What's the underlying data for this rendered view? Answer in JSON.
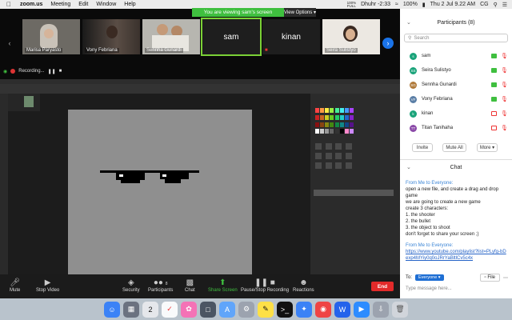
{
  "menubar": {
    "items": [
      "zoom.us",
      "Meeting",
      "Edit",
      "Window",
      "Help"
    ],
    "status": {
      "battery_pct": "100%",
      "battery_label": "FULL",
      "prayer": "Dhuhr -2:33",
      "percent": "100%",
      "datetime": "Thu 2 Jul  9.22 AM",
      "user": "CG"
    }
  },
  "banner": {
    "viewing": "You are viewing sam's screen",
    "view_options": "View Options ▾"
  },
  "gallery": [
    {
      "name": "Marisa Paryasto",
      "type": "video"
    },
    {
      "name": "Vony Febriana",
      "type": "video"
    },
    {
      "name": "Sennha Gunardi",
      "type": "video"
    },
    {
      "name": "sam",
      "type": "name",
      "active": true
    },
    {
      "name": "kinan",
      "type": "name"
    },
    {
      "name": "Seira Sulistyo",
      "type": "video"
    }
  ],
  "recording": {
    "label": "Recording..."
  },
  "controls": {
    "mute": "Mute",
    "stop_video": "Stop Video",
    "security": "Security",
    "participants": "Participants",
    "participants_count": "8",
    "chat": "Chat",
    "share_screen": "Share Screen",
    "pause_recording": "Pause/Stop Recording",
    "reactions": "Reactions",
    "end": "End"
  },
  "participants": {
    "header": "Participants (8)",
    "search_placeholder": "Search",
    "list": [
      {
        "name": "sam",
        "initial": "s",
        "color": "#1aa37a",
        "video_on": true,
        "mic_muted": true
      },
      {
        "name": "Seira Sulistyo",
        "initial": "SS",
        "color": "#1aa37a",
        "video_on": true,
        "mic_muted": true
      },
      {
        "name": "Sennha Gunardi",
        "initial": "SG",
        "color": "#b07a3a",
        "video_on": true,
        "mic_muted": true
      },
      {
        "name": "Vony Febriana",
        "initial": "VF",
        "color": "#5a7ea6",
        "video_on": true,
        "mic_muted": true
      },
      {
        "name": "kinan",
        "initial": "k",
        "color": "#1aa37a",
        "video_on": false,
        "mic_muted": true
      },
      {
        "name": "Titan Tanihaha",
        "initial": "TT",
        "color": "#8b4aa8",
        "video_on": false,
        "mic_muted": true
      }
    ],
    "invite": "Invite",
    "mute_all": "Mute All",
    "more": "More ▾"
  },
  "chat": {
    "header": "Chat",
    "messages": [
      {
        "from": "From Me to Everyone:",
        "lines": [
          "open a new file, and create a drag and drop game",
          "we are going to create a new game",
          "create 3 characters:",
          "1. the shooter",
          "2. the bullet",
          "3. the object to shoot",
          "don't forget to share your screen ;)"
        ]
      },
      {
        "from": "From Me to Everyone:",
        "link": "https://www.youtube.com/playlist?list=PLyfg-bDexp4MYiy0q0oJRrYaBltlCv5c4x"
      }
    ],
    "to_label": "To:",
    "to_value": "Everyone ▾",
    "file_btn": "File",
    "input_placeholder": "Type message here..."
  },
  "colors": {
    "accent_green": "#3fbf3f",
    "end_red": "#e22a2a",
    "link_blue": "#2563c7"
  }
}
